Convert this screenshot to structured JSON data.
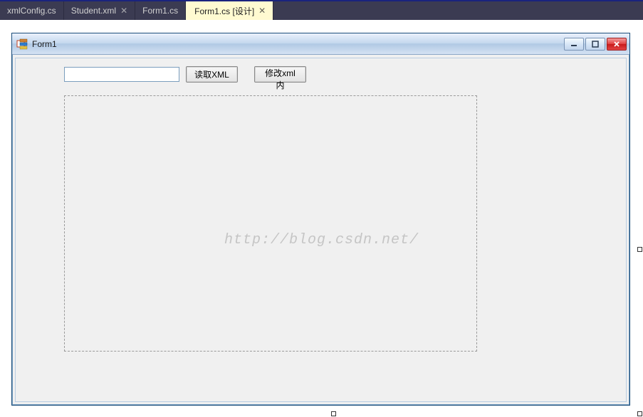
{
  "tabs": {
    "items": [
      {
        "label": "xmlConfig.cs",
        "active": false,
        "closable": false
      },
      {
        "label": "Student.xml",
        "active": false,
        "closable": true
      },
      {
        "label": "Form1.cs",
        "active": false,
        "closable": false
      },
      {
        "label": "Form1.cs [设计]",
        "active": true,
        "closable": true
      }
    ]
  },
  "winform": {
    "title": "Form1",
    "textbox_value": "",
    "button_read_label": "读取XML",
    "button_modify_label": "修改xml内"
  },
  "watermark": "http://blog.csdn.net/"
}
